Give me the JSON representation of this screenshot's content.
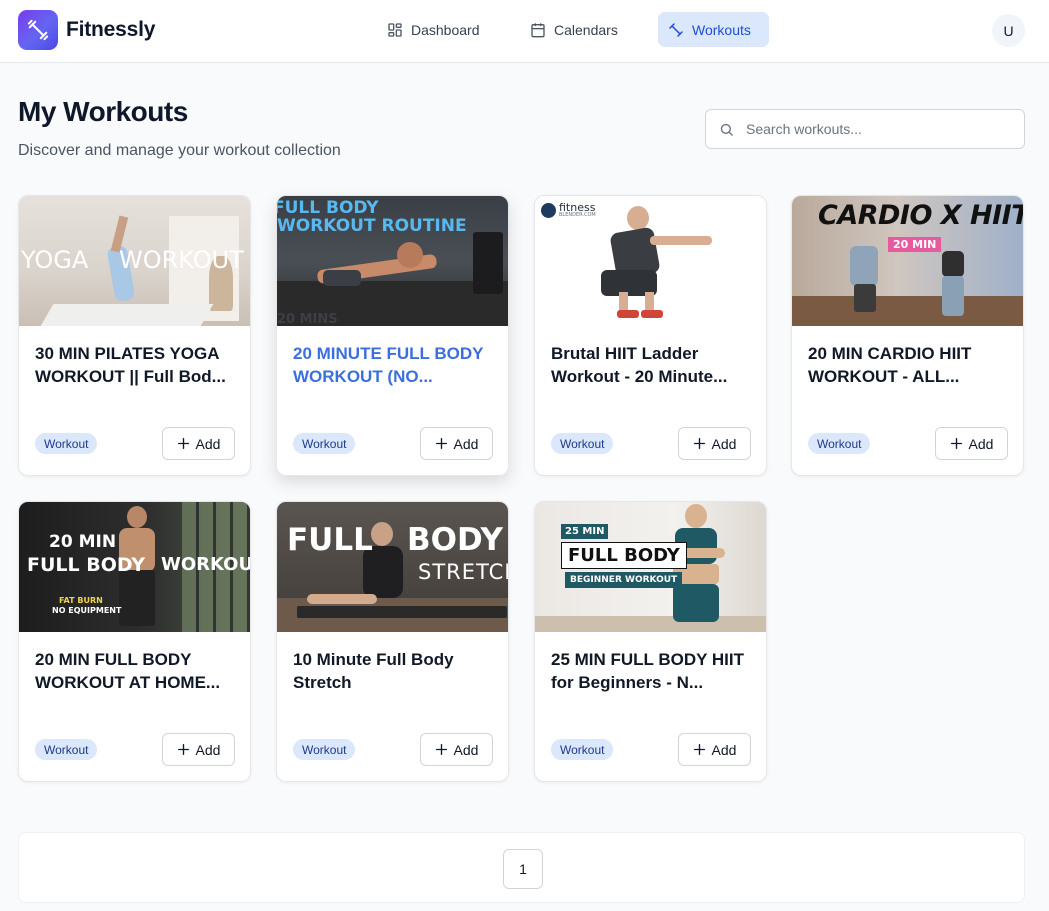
{
  "app": {
    "name": "Fitnessly",
    "user_initial": "U"
  },
  "nav": {
    "items": [
      {
        "label": "Dashboard",
        "icon": "dashboard-icon",
        "active": false
      },
      {
        "label": "Calendars",
        "icon": "calendar-icon",
        "active": false
      },
      {
        "label": "Workouts",
        "icon": "dumbbell-icon",
        "active": true
      }
    ]
  },
  "page": {
    "title": "My Workouts",
    "subtitle": "Discover and manage your workout collection"
  },
  "search": {
    "placeholder": "Search workouts...",
    "value": ""
  },
  "workouts": [
    {
      "title": "30 MIN PILATES YOGA WORKOUT || Full Bod...",
      "tag": "Workout",
      "add_label": "Add",
      "thumb_text": [
        "YOGA",
        "WORKOUT"
      ]
    },
    {
      "title": "20 MINUTE FULL BODY WORKOUT (NO...",
      "tag": "Workout",
      "add_label": "Add",
      "thumb_text": [
        "FULL BODY",
        "WORKOUT ROUTINE",
        "20 MINS"
      ]
    },
    {
      "title": "Brutal HIIT Ladder Workout - 20 Minute...",
      "tag": "Workout",
      "add_label": "Add",
      "thumb_text": [
        "fitness",
        "BLENDER.COM"
      ]
    },
    {
      "title": "20 MIN CARDIO HIIT WORKOUT - ALL...",
      "tag": "Workout",
      "add_label": "Add",
      "thumb_text": [
        "CARDIO X HIIT",
        "20 MIN"
      ]
    },
    {
      "title": "20 MIN FULL BODY WORKOUT AT HOME...",
      "tag": "Workout",
      "add_label": "Add",
      "thumb_text": [
        "20 MIN",
        "FULL BODY",
        "WORKOUT",
        "FAT BURN",
        "NO EQUIPMENT"
      ]
    },
    {
      "title": "10 Minute Full Body Stretch",
      "tag": "Workout",
      "add_label": "Add",
      "thumb_text": [
        "FULL",
        "BODY",
        "STRETCH"
      ]
    },
    {
      "title": "25 MIN FULL BODY HIIT for Beginners - N...",
      "tag": "Workout",
      "add_label": "Add",
      "thumb_text": [
        "25 MIN",
        "FULL BODY",
        "BEGINNER WORKOUT"
      ]
    }
  ],
  "pagination": {
    "current": "1"
  },
  "colors": {
    "accent": "#3b6fe0",
    "nav_active_bg": "#dbe7fb",
    "badge_bg": "#dbe7fb",
    "logo_gradient_start": "#7c3aed",
    "logo_gradient_end": "#4f46e5"
  }
}
